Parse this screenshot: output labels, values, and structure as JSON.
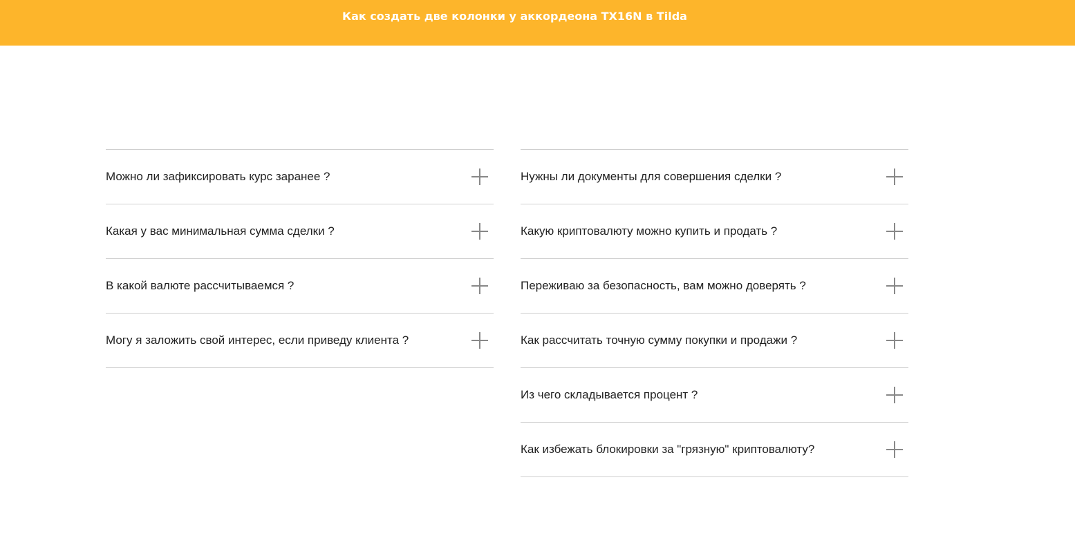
{
  "header": {
    "title": "Как создать две колонки у аккордеона TX16N в Tilda",
    "background_color": "#fdb52b"
  },
  "accordion": {
    "left_column": [
      {
        "question": "Можно ли зафиксировать курс заранее ?",
        "icon": "plus-icon"
      },
      {
        "question": "Какая у вас минимальная сумма сделки ?",
        "icon": "plus-icon"
      },
      {
        "question": "В какой валюте рассчитываемся ?",
        "icon": "plus-icon"
      },
      {
        "question": "Могу я заложить свой интерес, если приведу клиента ?",
        "icon": "plus-icon"
      }
    ],
    "right_column": [
      {
        "question": "Нужны ли документы для совершения сделки ?",
        "icon": "plus-icon"
      },
      {
        "question": "Какую криптовалюту можно купить и продать ?",
        "icon": "plus-icon"
      },
      {
        "question": "Переживаю за безопасность, вам можно доверять ?",
        "icon": "plus-icon"
      },
      {
        "question": "Как рассчитать точную сумму покупки и продажи ?",
        "icon": "plus-icon"
      },
      {
        "question": "Из чего складывается процент ?",
        "icon": "plus-icon"
      },
      {
        "question": "Как избежать блокировки за \"грязную\" криптовалюту?",
        "icon": "plus-icon"
      }
    ]
  }
}
